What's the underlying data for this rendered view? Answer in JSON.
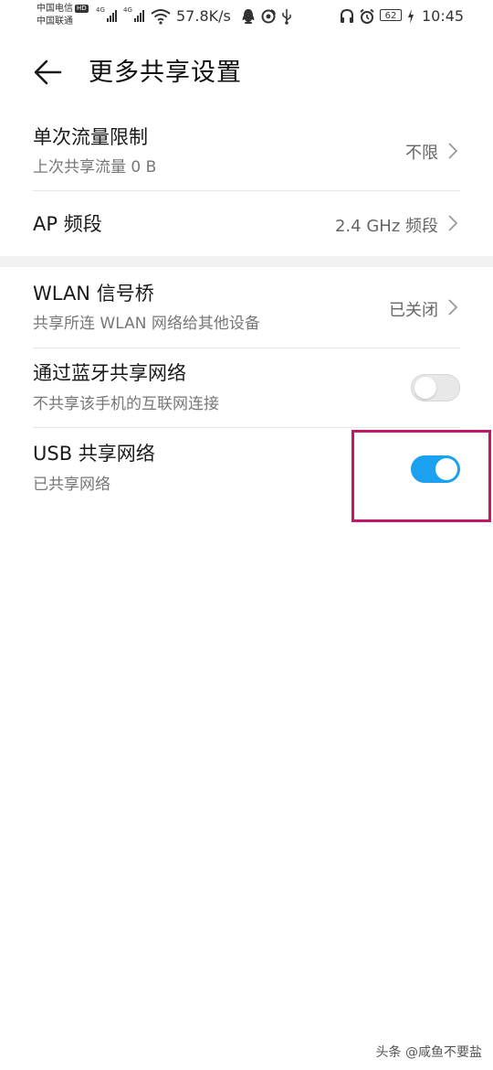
{
  "status_bar": {
    "carrier_1": "中国电信",
    "carrier_1_badge": "HD",
    "carrier_2": "中国联通",
    "network_type_1": "4G",
    "network_type_2": "4G",
    "net_speed": "57.8K/s",
    "battery_level": "62",
    "time": "10:45",
    "icons": [
      "wifi-icon",
      "qq-icon",
      "weibo-icon",
      "usb-icon",
      "headset-icon",
      "alarm-icon",
      "charging-icon"
    ]
  },
  "header": {
    "title": "更多共享设置"
  },
  "settings": [
    {
      "title": "单次流量限制",
      "subtitle": "上次共享流量 0 B",
      "value": "不限"
    },
    {
      "title": "AP 频段",
      "value": "2.4 GHz 频段"
    },
    {
      "title": "WLAN 信号桥",
      "subtitle": "共享所连 WLAN 网络给其他设备",
      "value": "已关闭"
    },
    {
      "title": "通过蓝牙共享网络",
      "subtitle": "不共享该手机的互联网连接",
      "toggle_on": false
    },
    {
      "title": "USB 共享网络",
      "subtitle": "已共享网络",
      "toggle_on": true
    }
  ],
  "colors": {
    "toggle_on": "#1ba1f0",
    "toggle_off": "#e8e8e8",
    "highlight_box": "#c2186b",
    "section_gap": "#f2f2f2"
  },
  "watermark": "头条 @咸鱼不要盐"
}
